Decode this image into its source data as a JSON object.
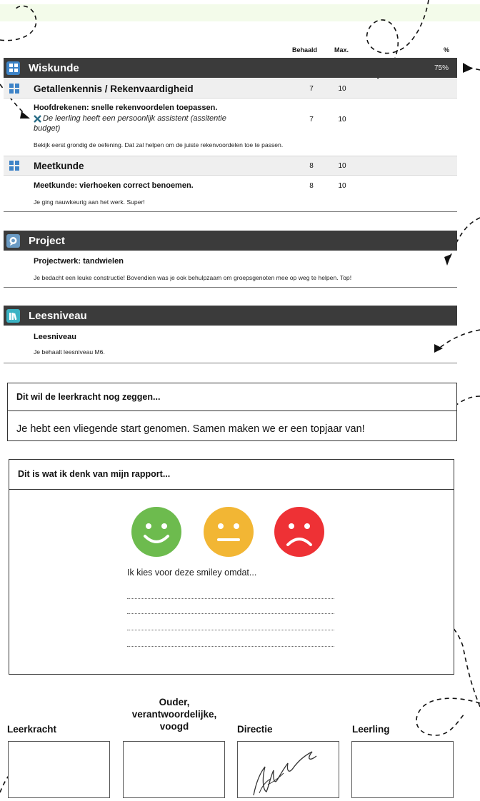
{
  "table_header": {
    "achieved": "Behaald",
    "max": "Max.",
    "percent": "%"
  },
  "sections": {
    "wiskunde": {
      "title": "Wiskunde",
      "percent": "75%",
      "icon": "grid-icon",
      "subs": [
        {
          "title": "Getallenkennis / Rekenvaardigheid",
          "achieved": "7",
          "max": "10",
          "goal": "Hoofdrekenen: snelle rekenvoordelen toepassen.",
          "goal_achieved": "7",
          "goal_max": "10",
          "support_line1": "De leerling heeft een persoonlijk assistent (assitentie",
          "support_line2": "budget)",
          "feedback": "Bekijk eerst grondig de oefening. Dat zal helpen om de juiste rekenvoordelen toe te passen."
        },
        {
          "title": "Meetkunde",
          "achieved": "8",
          "max": "10",
          "goal": "Meetkunde: vierhoeken correct benoemen.",
          "goal_achieved": "8",
          "goal_max": "10",
          "feedback": "Je ging nauwkeurig aan het werk. Super!"
        }
      ]
    },
    "project": {
      "title": "Project",
      "icon": "speech-bubble-icon",
      "goal": "Projectwerk: tandwielen",
      "feedback": "Je bedacht een leuke constructie! Bovendien was je ook behulpzaam om groepsgenoten mee op weg te helpen. Top!"
    },
    "leesniveau": {
      "title": "Leesniveau",
      "icon": "books-icon",
      "goal": "Leesniveau",
      "feedback": "Je behaalt leesniveau M6."
    }
  },
  "teacher_box": {
    "heading": "Dit wil de leerkracht nog zeggen...",
    "message": "Je hebt een vliegende start genomen. Samen maken we er een topjaar van!"
  },
  "reflection_box": {
    "heading": "Dit is wat ik denk van mijn rapport...",
    "smileys": [
      {
        "name": "happy",
        "color": "#6dbb4e"
      },
      {
        "name": "neutral",
        "color": "#f2b634"
      },
      {
        "name": "sad",
        "color": "#ee3135"
      }
    ],
    "prompt": "Ik kies voor deze smiley omdat..."
  },
  "signatures": {
    "teacher": "Leerkracht",
    "parent_line1": "Ouder,",
    "parent_line2": "verantwoordelijke,",
    "parent_line3": "voogd",
    "director": "Directie",
    "student": "Leerling"
  },
  "colors": {
    "section_bar": "#3b3b3b",
    "icon_blue": "#3d83c7",
    "icon_teal": "#3ab3c4",
    "top_band": "#f3fbea"
  }
}
